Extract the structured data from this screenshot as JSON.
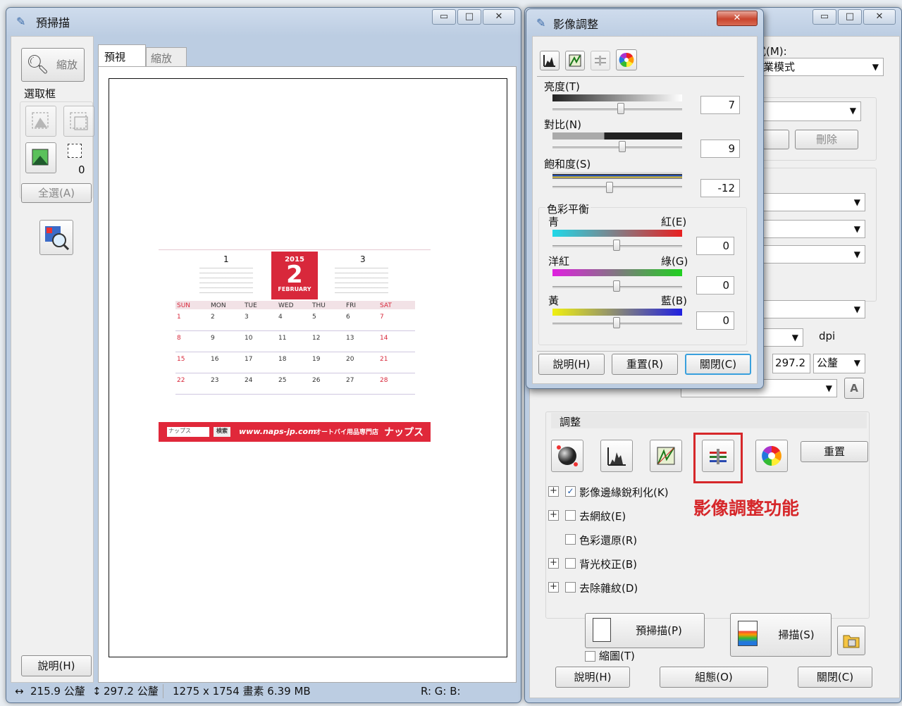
{
  "prescan": {
    "title": "預掃描",
    "zoom_label": "縮放",
    "marquee_label": "選取框",
    "marquee_count": "0",
    "select_all": "全選(A)",
    "tabs": [
      "預視",
      "縮放"
    ],
    "help_button": "說明(H)",
    "status_width": "215.9 公釐",
    "status_height": "297.2 公釐",
    "status_info": "1275 x 1754 畫素 6.39 MB",
    "status_rgb": "R: G: B:"
  },
  "calendar": {
    "year": "2015",
    "month_num": "2",
    "month_name": "FEBRUARY",
    "prev_month": "1",
    "next_month": "3",
    "days": [
      "SUN",
      "MON",
      "TUE",
      "WED",
      "THU",
      "FRI",
      "SAT"
    ],
    "weeks": [
      [
        "1",
        "2",
        "3",
        "4",
        "5",
        "6",
        "7"
      ],
      [
        "8",
        "9",
        "10",
        "11",
        "12",
        "13",
        "14"
      ],
      [
        "15",
        "16",
        "17",
        "18",
        "19",
        "20",
        "21"
      ],
      [
        "22",
        "23",
        "24",
        "25",
        "26",
        "27",
        "28"
      ]
    ],
    "footer_search": "ナップス",
    "footer_button": "検索",
    "footer_url": "www.naps-jp.com",
    "footer_shop": "オートバイ用品専門店",
    "footer_brand": "ナップス"
  },
  "main": {
    "mode_label": "式(M):",
    "mode_value": "業模式",
    "delete_button": "刪除",
    "dpi_label": "dpi",
    "size_value": "297.2",
    "unit_value": "公釐",
    "adjust_header": "調整",
    "reset_button": "重置",
    "annotation": "影像調整功能",
    "options": [
      {
        "label": "影像邊緣銳利化(K)",
        "checked": true,
        "expand": true
      },
      {
        "label": "去網紋(E)",
        "checked": false,
        "expand": true
      },
      {
        "label": "色彩還原(R)",
        "checked": false,
        "expand": false
      },
      {
        "label": "背光校正(B)",
        "checked": false,
        "expand": true
      },
      {
        "label": "去除雜紋(D)",
        "checked": false,
        "expand": true
      }
    ],
    "prescan_button": "預掃描(P)",
    "scan_button": "掃描(S)",
    "thumbnail_label": "縮圖(T)",
    "help_button": "說明(H)",
    "config_button": "組態(O)",
    "close_button": "關閉(C)"
  },
  "adjust": {
    "title": "影像調整",
    "brightness_label": "亮度(T)",
    "brightness_value": "7",
    "contrast_label": "對比(N)",
    "contrast_value": "9",
    "saturation_label": "飽和度(S)",
    "saturation_value": "-12",
    "balance_header": "色彩平衡",
    "cyan": "青",
    "red": "紅(E)",
    "cyan_red_value": "0",
    "magenta": "洋紅",
    "green": "綠(G)",
    "magenta_green_value": "0",
    "yellow": "黃",
    "blue": "藍(B)",
    "yellow_blue_value": "0",
    "help_button": "說明(H)",
    "reset_button": "重置(R)",
    "close_button": "關閉(C)"
  },
  "colors": {
    "annotation_red": "#d6272a",
    "calendar_red": "#d8283b",
    "footer_red": "#e0283a"
  }
}
